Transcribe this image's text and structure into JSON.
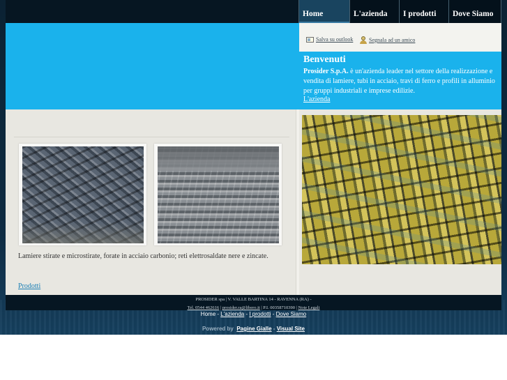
{
  "nav": {
    "items": [
      {
        "label": "Home",
        "active": true
      },
      {
        "label": "L'azienda"
      },
      {
        "label": "I prodotti"
      },
      {
        "label": "Dove Siamo"
      }
    ]
  },
  "utility": {
    "save_outlook": "Salva su outlook",
    "tell_friend": "Segnala ad un amico"
  },
  "welcome": {
    "title": "Benvenuti",
    "company": "Prosider S.p.A.",
    "text": " è un'azienda leader nel settore della realizzazione e vendita di lamiere, tubi in acciaio, travi di ferro e profili in alluminio per gruppi industriali e imprese edilizie.",
    "link": "L'azienda"
  },
  "products": {
    "caption": "Lamiere stirate e microstirate, forate in acciaio carbonio; reti elettrosaldate nere e zincate.",
    "link": "Prodotti"
  },
  "footer": {
    "line1": "PROSIDER spa | V. VALLE BARTINA 14 - RAVENNA (RA) -",
    "line2_tel": "Tel. 0544 462616",
    "line2_email": "prosider.ra@libero.it",
    "line2_piva": "P.I. 00358710390",
    "line2_legal": "Note Legali"
  },
  "bottom_nav": {
    "home": "Home",
    "azienda": "L'azienda",
    "prodotti": "I prodotti",
    "dove": "Dove Siamo",
    "sep": " - "
  },
  "powered": {
    "label": "Powered by",
    "pagine": "Pagine Gialle",
    "sep": " - ",
    "visual": "Visual Site"
  },
  "colors": {
    "accent_blue": "#1ab2ec",
    "dark_bar": "#061622",
    "content_bg": "#e8e7e1"
  }
}
